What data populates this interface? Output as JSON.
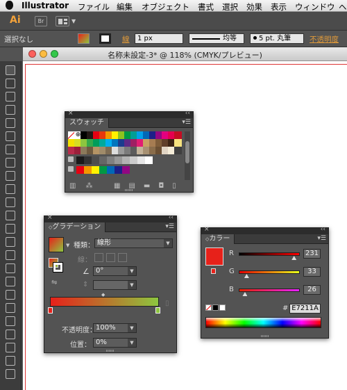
{
  "menubar": {
    "app_name": "Illustrator",
    "items": [
      "ファイル",
      "編集",
      "オブジェクト",
      "書式",
      "選択",
      "効果",
      "表示",
      "ウィンドウ",
      "ヘ"
    ]
  },
  "appbar": {
    "logo": "Ai",
    "bridge": "Br"
  },
  "control": {
    "selection": "選択なし",
    "stroke_label": "線",
    "stroke_weight": "1 px",
    "profile": "均等",
    "brush": "5 pt. 丸筆",
    "opacity_label": "不透明度"
  },
  "document": {
    "title": "名称未設定-3* @ 118% (CMYK/プレビュー)"
  },
  "swatches": {
    "title": "スウォッチ",
    "rows": [
      [
        "#ffffff",
        "#ffffff",
        "#000000",
        "#231815",
        "#e60012",
        "#e8380d",
        "#f39800",
        "#fff100",
        "#8fc31f",
        "#009944",
        "#009e96",
        "#00a0e9",
        "#0068b7",
        "#1d2088",
        "#920783",
        "#e4007f",
        "#e5004f",
        "#c30d23"
      ],
      [
        "#f3e100",
        "#d7df23",
        "#8dc63f",
        "#35a94a",
        "#009c5a",
        "#00a99d",
        "#00aeef",
        "#0076be",
        "#1b3c8e",
        "#5f2a86",
        "#9e1f63",
        "#e21d73",
        "#c8a063",
        "#a67c52",
        "#7f5d3a",
        "#603f2a",
        "#3c2415",
        "#f6e27f"
      ],
      [
        "#b72b4a",
        "#9b1f3a",
        "#8c7a5b",
        "#6f5a3f",
        "#b59465",
        "#a08b6a",
        "#7d6b53",
        "#ddd",
        "#9a9a9a",
        "#7b7b7b",
        "#5c5c5c",
        "#c4b39a",
        "#a79173",
        "#8a6d4b",
        "#6b4f33",
        "#e0d4c4",
        "#f4ecd8",
        "#3f3f3f"
      ]
    ],
    "gray_row": [
      "#1a1a1a",
      "#333333",
      "#4d4d4d",
      "#666666",
      "#808080",
      "#999999",
      "#b3b3b3",
      "#cccccc",
      "#e6e6e6",
      "#ffffff"
    ],
    "folder_row": [
      "#e50012",
      "#f39800",
      "#fff100",
      "#009944",
      "#0068b7",
      "#1d2088",
      "#920783"
    ],
    "colors": {
      "bg": "#535353",
      "header": "#2c2c2c"
    }
  },
  "gradient": {
    "title": "グラデーション",
    "type_label": "種類：",
    "type_value": "線形",
    "stroke_label": "線：",
    "angle_value": "0°",
    "opacity_label": "不透明度：",
    "opacity_value": "100%",
    "position_label": "位置：",
    "position_value": "0%",
    "start_color": "#e7211a",
    "end_color": "#8dc63f"
  },
  "color": {
    "title": "カラー",
    "r_label": "R",
    "g_label": "G",
    "b_label": "B",
    "r_value": "231",
    "g_value": "33",
    "b_value": "26",
    "r": 231,
    "g": 33,
    "b": 26,
    "hex_label": "#",
    "hex_value": "E7211A",
    "swatch_color": "#e7211a"
  }
}
